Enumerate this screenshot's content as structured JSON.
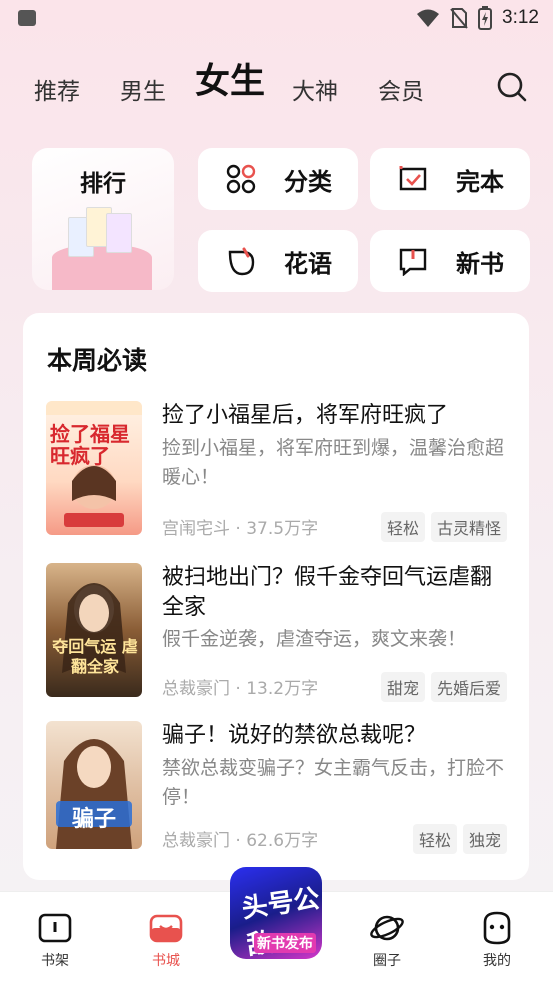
{
  "status": {
    "time": "3:12"
  },
  "nav": {
    "tabs": [
      {
        "label": "推荐"
      },
      {
        "label": "男生"
      },
      {
        "label": "女生"
      },
      {
        "label": "大神"
      },
      {
        "label": "会员"
      }
    ],
    "active_tab": "女生"
  },
  "entries": {
    "rank": "排行",
    "category": "分类",
    "finished": "完本",
    "huayu": "花语",
    "newbook": "新书"
  },
  "weekly": {
    "title": "本周必读",
    "books": [
      {
        "title": "捡了小福星后，将军府旺疯了",
        "desc": "捡到小福星，将军府旺到爆，温馨治愈超暖心！",
        "category": "宫闱宅斗",
        "words": "37.5万字",
        "tags": [
          "轻松",
          "古灵精怪"
        ],
        "cover_text": "捡了福星 旺疯了"
      },
      {
        "title": "被扫地出门？假千金夺回气运虐翻全家",
        "desc": "假千金逆袭，虐渣夺运，爽文来袭！",
        "category": "总裁豪门",
        "words": "13.2万字",
        "tags": [
          "甜宠",
          "先婚后爱"
        ],
        "cover_text": "夺回气运 虐翻全家"
      },
      {
        "title": "骗子！说好的禁欲总裁呢？",
        "desc": "禁欲总裁变骗子？女主霸气反击，打脸不停！",
        "category": "总裁豪门",
        "words": "62.6万字",
        "tags": [
          "轻松",
          "独宠"
        ],
        "cover_text": "骗子"
      }
    ]
  },
  "bottom": {
    "items": [
      {
        "label": "书架"
      },
      {
        "label": "书城"
      },
      {
        "label": "圈子"
      },
      {
        "label": "我的"
      }
    ],
    "promo_line1": "头号公敌",
    "promo_line2": "新书发布"
  },
  "colors": {
    "accent": "#e8524e",
    "pink_bg": "#fbe4ea"
  }
}
